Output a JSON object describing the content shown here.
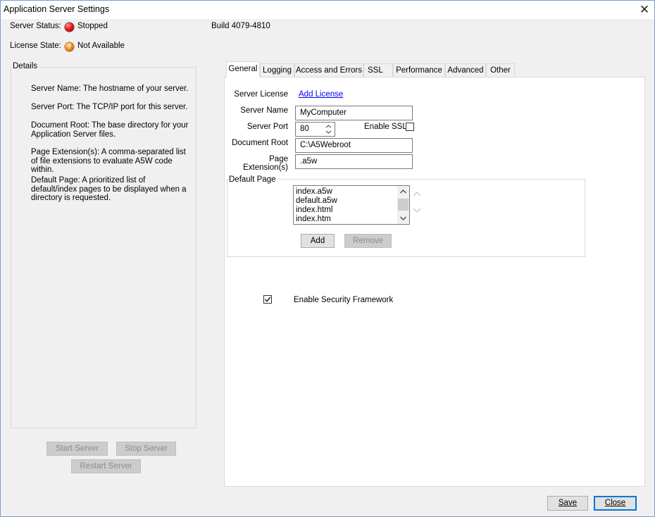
{
  "window": {
    "title": "Application Server Settings"
  },
  "status": {
    "server_status_label": "Server Status:",
    "server_status_value": "Stopped",
    "license_state_label": "License State:",
    "license_state_value": "Not Available",
    "build": "Build 4079-4810"
  },
  "details": {
    "legend": "Details",
    "paragraphs": [
      "Server Name: The hostname of your server.",
      "Server Port: The TCP/IP port for this server.",
      "Document Root: The base directory for your Application Server files.",
      "Page Extension(s): A comma-separated list of file extensions to evaluate A5W code within.",
      "Default Page: A prioritized list of default/index pages to be displayed when a directory is requested."
    ]
  },
  "server_buttons": {
    "start": "Start Server",
    "stop": "Stop Server",
    "restart": "Restart Server"
  },
  "tabs": [
    {
      "label": "General",
      "active": true
    },
    {
      "label": "Logging"
    },
    {
      "label": "Access and Errors"
    },
    {
      "label": "SSL"
    },
    {
      "label": "Performance"
    },
    {
      "label": "Advanced"
    },
    {
      "label": "Other"
    }
  ],
  "general": {
    "server_license_label": "Server License",
    "add_license_link": "Add License",
    "server_name_label": "Server Name",
    "server_name_value": "MyComputer",
    "server_port_label": "Server Port",
    "server_port_value": "80",
    "enable_ssl_label": "Enable SSL",
    "enable_ssl_checked": false,
    "document_root_label": "Document Root",
    "document_root_value": "C:\\A5Webroot",
    "page_extensions_label": "Page Extension(s)",
    "page_extensions_value": ".a5w",
    "default_page_legend": "Default Page",
    "default_pages": [
      "index.a5w",
      "default.a5w",
      "index.html",
      "index.htm"
    ],
    "add_button": "Add",
    "remove_button": "Remove",
    "enable_security_label": "Enable Security Framework",
    "enable_security_checked": true
  },
  "footer": {
    "save": "Save",
    "close": "Close"
  },
  "icons": {
    "stopped_status": "red-circle-icon",
    "license_status": "question-circle-icon",
    "close": "close-icon"
  },
  "colors": {
    "accent": "#0078d7",
    "link": "#0000ee",
    "stopped": "#e02020",
    "warning": "#e98a1e"
  }
}
